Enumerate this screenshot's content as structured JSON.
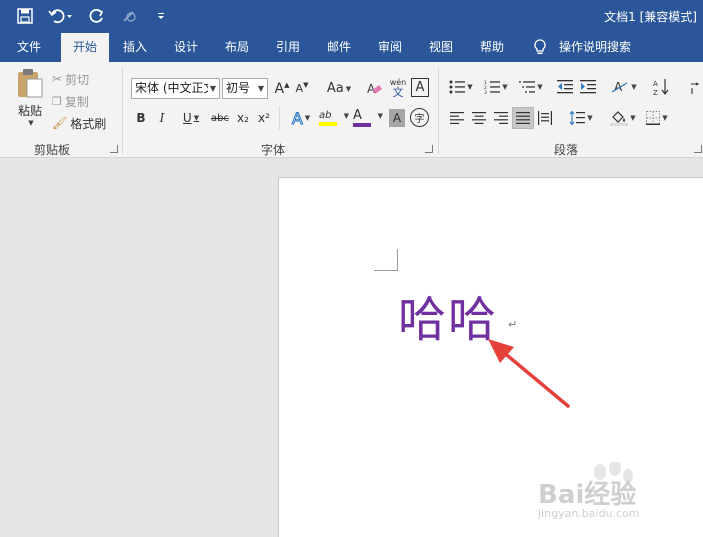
{
  "window": {
    "title": "文档1 [兼容模式]"
  },
  "tabs": [
    {
      "label": "文件"
    },
    {
      "label": "开始"
    },
    {
      "label": "插入"
    },
    {
      "label": "设计"
    },
    {
      "label": "布局"
    },
    {
      "label": "引用"
    },
    {
      "label": "邮件"
    },
    {
      "label": "审阅"
    },
    {
      "label": "视图"
    },
    {
      "label": "帮助"
    }
  ],
  "tell_me": {
    "label": "操作说明搜索"
  },
  "clipboard": {
    "paste_label": "粘贴",
    "cut_label": "剪切",
    "copy_label": "复制",
    "format_painter_label": "格式刷",
    "group_label": "剪贴板"
  },
  "font": {
    "font_name": "宋体 (中文正文",
    "font_size": "初号",
    "grow_label": "A",
    "shrink_label": "A",
    "case_label": "Aa",
    "phonetic_top": "wén",
    "phonetic_bottom": "文",
    "border_char_label": "A",
    "bold_label": "B",
    "italic_label": "I",
    "underline_label": "U",
    "strike_label": "abc",
    "subscript_label": "x₂",
    "superscript_label": "x²",
    "effects_label": "A",
    "highlight_label": "ab",
    "color_label": "A",
    "shading_label": "A",
    "enclose_label": "字",
    "group_label": "字体",
    "highlight_color": "#ffff00",
    "font_color": "#7030a0"
  },
  "paragraph": {
    "group_label": "段落"
  },
  "document": {
    "text": "哈哈",
    "paragraph_mark": "↵",
    "text_color": "#7030a0"
  },
  "annotation": {
    "arrow_color": "#e5403a"
  },
  "watermark": {
    "brand": "Bai经验",
    "url": "jingyan.baidu.com"
  }
}
